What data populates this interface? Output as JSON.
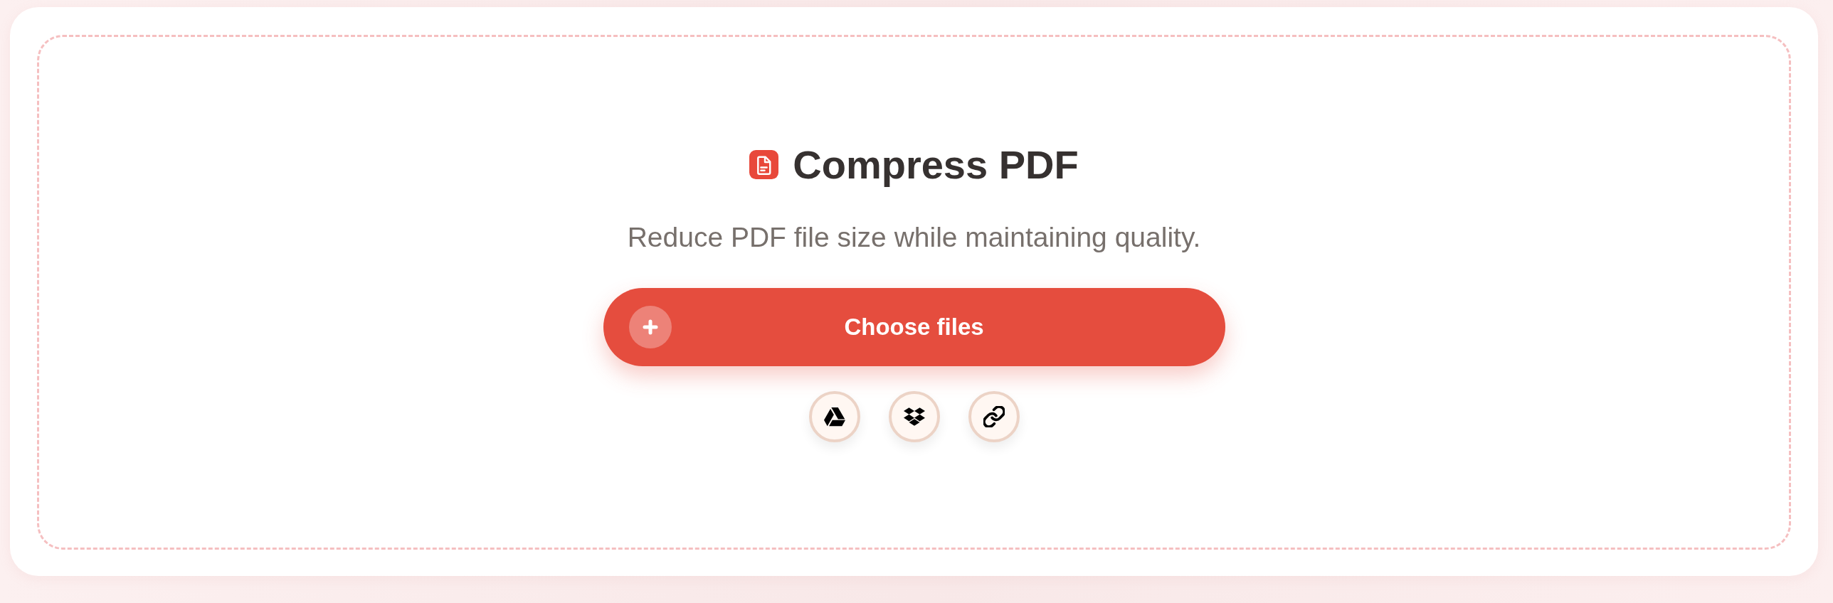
{
  "tool": {
    "title": "Compress PDF",
    "subtitle": "Reduce PDF file size while maintaining quality."
  },
  "upload_button": {
    "label": "Choose files"
  },
  "sources": [
    {
      "kind": "drive"
    },
    {
      "kind": "dropbox"
    },
    {
      "kind": "link"
    }
  ]
}
